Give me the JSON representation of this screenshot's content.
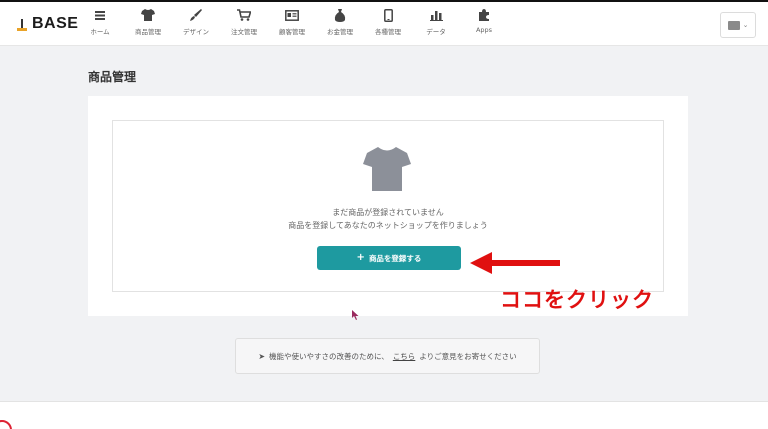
{
  "brand": {
    "logo_text": "BASE"
  },
  "nav": {
    "items": [
      {
        "label": "ホーム",
        "icon": "menu-icon"
      },
      {
        "label": "商品管理",
        "icon": "tshirt-icon"
      },
      {
        "label": "デザイン",
        "icon": "brush-icon"
      },
      {
        "label": "注文管理",
        "icon": "cart-icon"
      },
      {
        "label": "顧客管理",
        "icon": "id-card-icon"
      },
      {
        "label": "お金管理",
        "icon": "money-bag-icon"
      },
      {
        "label": "各種管理",
        "icon": "phone-icon"
      },
      {
        "label": "データ",
        "icon": "bar-chart-icon"
      },
      {
        "label": "Apps",
        "icon": "puzzle-icon"
      }
    ]
  },
  "page": {
    "title": "商品管理",
    "empty_state": {
      "line1": "まだ商品が登録されていません",
      "line2": "商品を登録してあなたのネットショップを作りましょう"
    },
    "register_button": {
      "label": "商品を登録する",
      "icon": "plus-icon"
    }
  },
  "annotation": {
    "text": "ココをクリック",
    "color": "#e01010"
  },
  "feedback": {
    "before": "機能や使いやすさの改善のために、",
    "link": "こちら",
    "after": "よりご意見をお寄せください"
  },
  "colors": {
    "accent": "#1e9aa0",
    "background": "#f1f2f4",
    "annotation": "#e01010"
  }
}
